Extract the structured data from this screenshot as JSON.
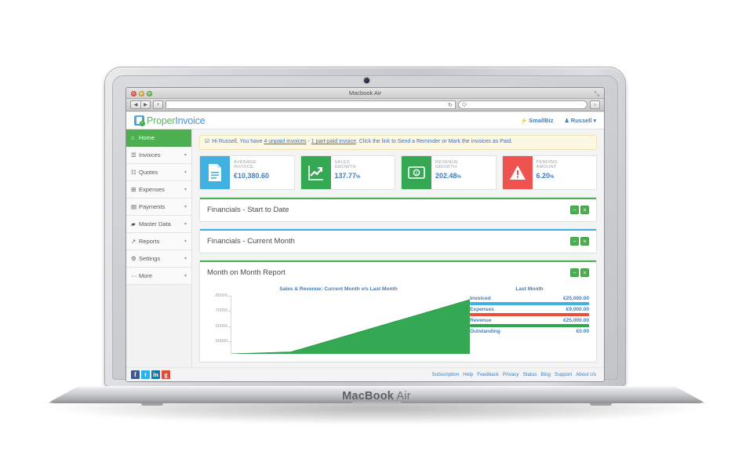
{
  "device": {
    "bezel_label_bold": "MacBook",
    "bezel_label_light": " Air"
  },
  "browser": {
    "window_title": "Macbook Air",
    "address_value": "",
    "search_placeholder": "Q-",
    "back_glyph": "◀",
    "forward_glyph": "▶",
    "add_glyph": "+",
    "reload_glyph": "↻",
    "fullscreen_glyph": "⤡"
  },
  "header": {
    "logo_part1": "Proper",
    "logo_part2": "Invoice",
    "logo_check": "✓",
    "plan_label": "SmallBiz",
    "plan_icon": "⚡",
    "user_label": "Russell",
    "user_icon": "♟",
    "user_caret": "▾"
  },
  "sidebar": {
    "items": [
      {
        "label": "Home",
        "icon": "⌂",
        "caret": "",
        "active": true
      },
      {
        "label": "Invoices",
        "icon": "☰",
        "caret": "▾",
        "active": false
      },
      {
        "label": "Quotes",
        "icon": "☷",
        "caret": "▾",
        "active": false
      },
      {
        "label": "Expenses",
        "icon": "⊞",
        "caret": "▾",
        "active": false
      },
      {
        "label": "Payments",
        "icon": "▤",
        "caret": "▾",
        "active": false
      },
      {
        "label": "Master Data",
        "icon": "▰",
        "caret": "▾",
        "active": false
      },
      {
        "label": "Reports",
        "icon": "↗",
        "caret": "▾",
        "active": false
      },
      {
        "label": "Settings",
        "icon": "⚙",
        "caret": "▾",
        "active": false
      },
      {
        "label": "More",
        "icon": "⋯",
        "caret": "▾",
        "active": false
      }
    ]
  },
  "alert": {
    "bell_icon": "☑",
    "text_1": "Hi Russell, You have ",
    "link_1": "4 unpaid invoices",
    "text_2": " - ",
    "link_2": "1 part-paid invoice",
    "text_3": ". Click the link to Send a Reminder or Mark the invoices as Paid."
  },
  "stats": [
    {
      "label_1": "AVERAGE",
      "label_2": "INVOICE",
      "value": "€10,380.60",
      "unit": "",
      "icon": "Ὄ4",
      "color": "#41b1e1"
    },
    {
      "label_1": "SALES",
      "label_2": "GROWTH",
      "value": "137.77",
      "unit": "%",
      "icon": "↗",
      "color": "#34a853"
    },
    {
      "label_1": "REVENUE",
      "label_2": "GROWTH",
      "value": "202.48",
      "unit": "%",
      "icon": "Ⓢ",
      "color": "#34a853"
    },
    {
      "label_1": "PENDING",
      "label_2": "AMOUNT",
      "value": "6.20",
      "unit": "%",
      "icon": "⚠",
      "color": "#ef5350"
    }
  ],
  "panels": [
    {
      "title": "Financials - Start to Date",
      "accent": "#4cb050",
      "minimize": "−",
      "close": "×"
    },
    {
      "title": "Financials - Current Month",
      "accent": "#41b1e1",
      "minimize": "−",
      "close": "×"
    },
    {
      "title": "Month on Month Report",
      "accent": "#4cb050",
      "minimize": "−",
      "close": "×"
    }
  ],
  "chart_data": {
    "type": "area",
    "title": "Sales & Revenue: Current Month v/s Last Month",
    "legend_title": "Last Month",
    "xlabel": "",
    "ylabel": "",
    "yticks": [
      "80000",
      "70000",
      "60000",
      "50000"
    ],
    "ylim": [
      40000,
      85000
    ],
    "grid": false,
    "legend_position": "right",
    "series": [
      {
        "name": "Current Month v/s Last Month",
        "color": "#34a853",
        "x": [
          0,
          25,
          100
        ],
        "values": [
          40000,
          41500,
          82000
        ]
      }
    ],
    "legend_entries": [
      {
        "name": "Invoiced",
        "value": "€25,000.00",
        "bar_pct": 100,
        "color": "#41b1e1"
      },
      {
        "name": "Expenses",
        "value": "€9,000.00",
        "bar_pct": 100,
        "color": "#e8503a"
      },
      {
        "name": "Revenue",
        "value": "€25,000.00",
        "bar_pct": 100,
        "color": "#2fa84f"
      },
      {
        "name": "Outstanding",
        "value": "€0.00",
        "bar_pct": 0,
        "color": "#2fa84f"
      }
    ]
  },
  "footer": {
    "socials": [
      {
        "name": "facebook",
        "glyph": "f"
      },
      {
        "name": "twitter",
        "glyph": "t"
      },
      {
        "name": "linkedin",
        "glyph": "in"
      },
      {
        "name": "googleplus",
        "glyph": "g"
      }
    ],
    "links": [
      "Subscription",
      "Help",
      "Feedback",
      "Privacy",
      "Status",
      "Blog",
      "Support",
      "About Us"
    ]
  }
}
